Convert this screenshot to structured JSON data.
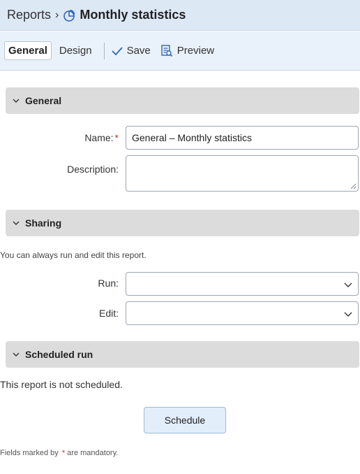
{
  "header": {
    "breadcrumb": "Reports",
    "separator": "›",
    "title": "Monthly statistics",
    "icon": "pie-chart-icon"
  },
  "toolbar": {
    "tab_general": "General",
    "tab_design": "Design",
    "save_label": "Save",
    "preview_label": "Preview"
  },
  "general": {
    "section_title": "General",
    "name_label": "Name:",
    "required_marker": "*",
    "name_value": "General – Monthly statistics",
    "description_label": "Description:",
    "description_value": ""
  },
  "sharing": {
    "section_title": "Sharing",
    "info": "You can always run and edit this report.",
    "run_label": "Run:",
    "run_value": "",
    "edit_label": "Edit:",
    "edit_value": ""
  },
  "scheduled": {
    "section_title": "Scheduled run",
    "status": "This report is not scheduled.",
    "schedule_button": "Schedule"
  },
  "footer": {
    "prefix": "Fields marked by",
    "marker": "*",
    "suffix": "are mandatory."
  },
  "colors": {
    "header_bg": "#dde8f5",
    "toolbar_bg": "#e9f1fa",
    "section_bg": "#dcdcdc",
    "required": "#c0392b",
    "icon_blue": "#2b66b8"
  }
}
